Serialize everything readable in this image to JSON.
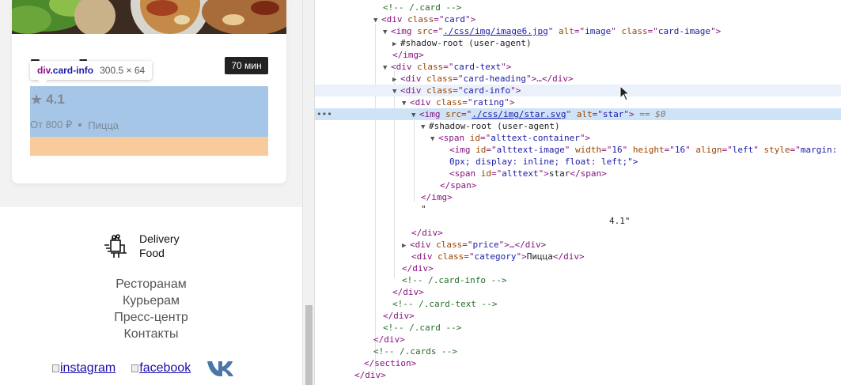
{
  "page": {
    "card": {
      "heading": "Пицца Б",
      "time_badge": "70 мин",
      "rating": "4.1",
      "price": "От 800 ₽",
      "category": "Пицца"
    },
    "inspect_tooltip": {
      "tag": "div",
      "class_name": ".card-info",
      "size": "300.5 × 64"
    },
    "footer": {
      "logo_line1": "Delivery",
      "logo_line2": "Food",
      "links": [
        "Ресторанам",
        "Курьерам",
        "Пресс-центр",
        "Контакты"
      ],
      "social": {
        "instagram": "instagram",
        "facebook": "facebook",
        "vk_icon": "vk-icon"
      }
    }
  },
  "devtools": {
    "lines": [
      {
        "comment": "<!-- /.card -->"
      },
      {
        "open_tag": "div",
        "attrs": [
          [
            "class",
            "card"
          ]
        ]
      },
      {
        "open_tag": "img",
        "attrs": [
          [
            "src",
            "./css/img/image6.jpg"
          ],
          [
            "alt",
            "image"
          ],
          [
            "class",
            "card-image"
          ]
        ]
      },
      {
        "shadow": "#shadow-root (user-agent)"
      },
      {
        "close_tag": "img"
      },
      {
        "open_tag": "div",
        "attrs": [
          [
            "class",
            "card-text"
          ]
        ]
      },
      {
        "open_tag": "div",
        "attrs": [
          [
            "class",
            "card-heading"
          ]
        ],
        "collapsed": "…</div>"
      },
      {
        "open_tag": "div",
        "attrs": [
          [
            "class",
            "card-info"
          ]
        ]
      },
      {
        "open_tag": "div",
        "attrs": [
          [
            "class",
            "rating"
          ]
        ]
      },
      {
        "open_tag": "img",
        "attrs": [
          [
            "src",
            "./css/img/star.svg"
          ],
          [
            "alt",
            "star"
          ]
        ],
        "suffix": "== $0"
      },
      {
        "shadow": "#shadow-root (user-agent)"
      },
      {
        "open_tag": "span",
        "attrs": [
          [
            "id",
            "alttext-container"
          ]
        ]
      },
      {
        "open_tag": "img",
        "attrs": [
          [
            "id",
            "alttext-image"
          ],
          [
            "width",
            "16"
          ],
          [
            "height",
            "16"
          ],
          [
            "align",
            "left"
          ],
          [
            "style",
            "margin:"
          ]
        ]
      },
      {
        "continuation": "0px; display: inline; float: left;\">"
      },
      {
        "open_tag": "span",
        "attrs": [
          [
            "id",
            "alttext"
          ]
        ],
        "inner": "star",
        "close": "span"
      },
      {
        "close_tag": "span"
      },
      {
        "close_tag": "img"
      },
      {
        "text": "\""
      },
      {
        "text": "4.1\""
      },
      {
        "close_tag": "div"
      },
      {
        "open_tag": "div",
        "attrs": [
          [
            "class",
            "price"
          ]
        ],
        "collapsed": "…</div>"
      },
      {
        "open_tag": "div",
        "attrs": [
          [
            "class",
            "category"
          ]
        ],
        "inner": "Пицца",
        "close": "div"
      },
      {
        "close_tag": "div"
      },
      {
        "comment": "<!-- /.card-info -->"
      },
      {
        "close_tag": "div"
      },
      {
        "comment": "<!-- /.card-text -->"
      },
      {
        "close_tag": "div"
      },
      {
        "comment": "<!-- /.card -->"
      },
      {
        "close_tag": "div"
      },
      {
        "comment": "<!-- /.cards -->"
      },
      {
        "close_tag": "section"
      },
      {
        "close_tag": "div"
      }
    ],
    "row_indicator": "•••"
  }
}
